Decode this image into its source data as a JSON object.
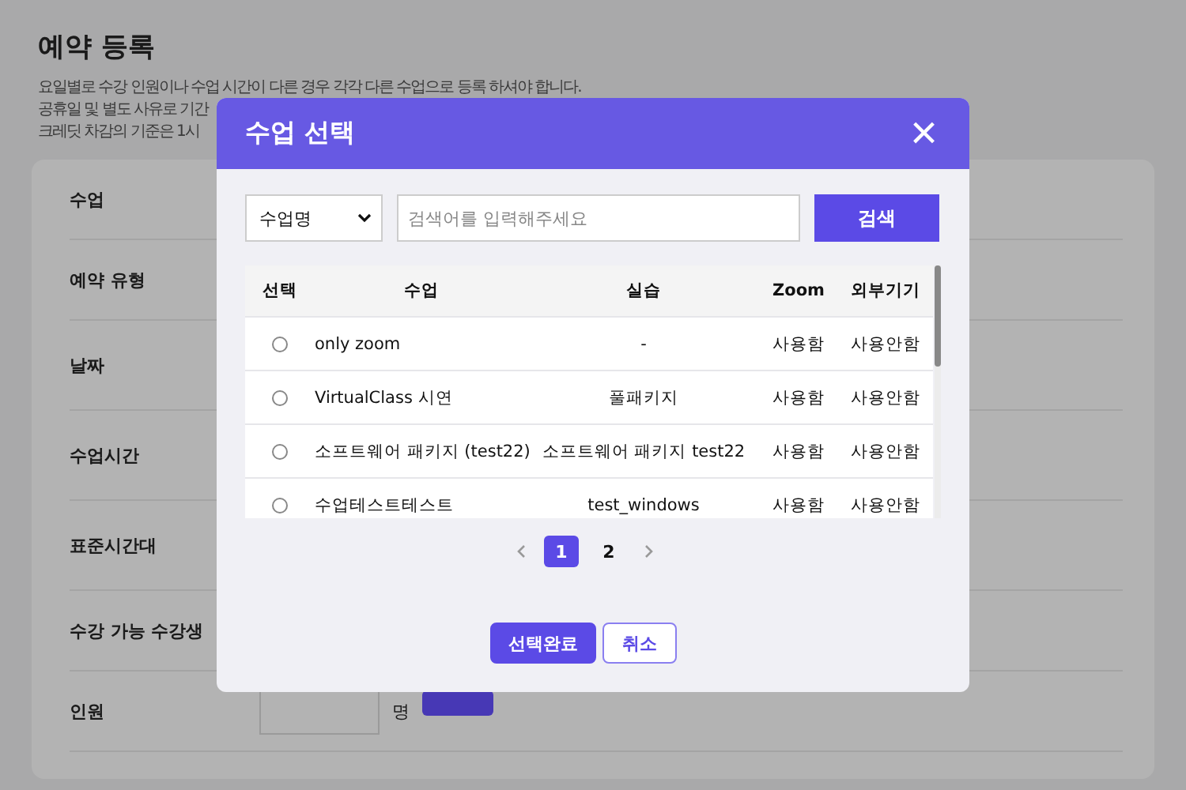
{
  "page": {
    "title": "예약 등록",
    "notes": [
      "요일별로 수강 인원이나 수업 시간이 다른 경우 각각 다른 수업으로 등록 하셔야 합니다.",
      "공휴일 및 별도 사유로 기간",
      "크레딧 차감의 기준은 1시"
    ],
    "fields": [
      {
        "label": "수업"
      },
      {
        "label": "예약 유형"
      },
      {
        "label": "날짜"
      },
      {
        "label": "수업시간"
      },
      {
        "label": "표준시간대"
      },
      {
        "label": "수강 가능 수강생"
      },
      {
        "label": "인원",
        "unit": "명"
      }
    ]
  },
  "modal": {
    "title": "수업 선택",
    "close": "×",
    "search": {
      "filter": "수업명",
      "placeholder": "검색어를 입력해주세요",
      "button": "검색"
    },
    "columns": [
      "선택",
      "수업",
      "실습",
      "Zoom",
      "외부기기"
    ],
    "rows": [
      {
        "selected": false,
        "name": "only zoom",
        "lab": "-",
        "zoom": "사용함",
        "device": "사용안함"
      },
      {
        "selected": false,
        "name": "VirtualClass 시연",
        "lab": "풀패키지",
        "zoom": "사용함",
        "device": "사용안함"
      },
      {
        "selected": false,
        "name": "소프트웨어 패키지 (test22)",
        "lab": "소프트웨어 패키지 test22",
        "zoom": "사용함",
        "device": "사용안함"
      },
      {
        "selected": false,
        "name": "수업테스트테스트",
        "lab": "test_windows",
        "zoom": "사용함",
        "device": "사용안함"
      }
    ],
    "pages": [
      {
        "label": "1",
        "selected": true
      },
      {
        "label": "2",
        "selected": false
      }
    ],
    "buttons": [
      {
        "kind": "primary",
        "label": "선택완료"
      },
      {
        "kind": "secondary",
        "label": "취소"
      }
    ]
  }
}
